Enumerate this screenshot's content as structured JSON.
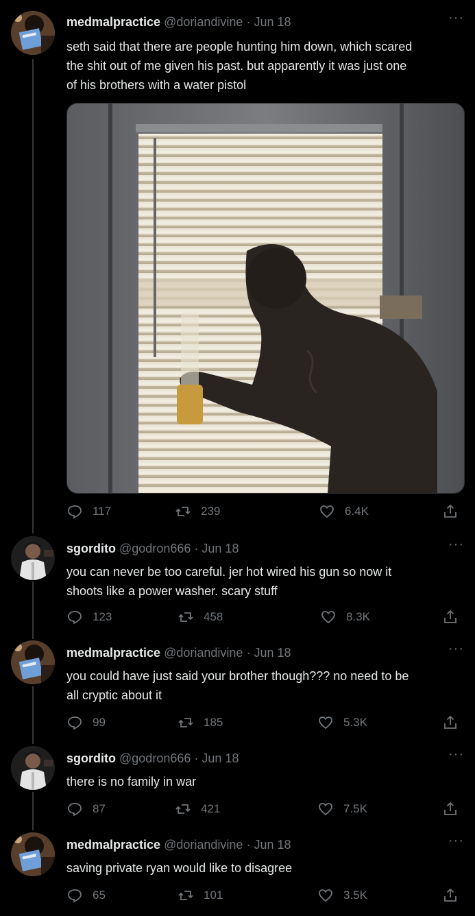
{
  "tweets": [
    {
      "name": "medmalpractice",
      "handle": "@doriandivine",
      "date": "Jun 18",
      "text_lines": [
        "seth said that there are people hunting him down, which scared",
        "the shit out of me given his past. but apparently it was just one",
        "of his brothers with a water pistol"
      ],
      "replies": "117",
      "retweets": "239",
      "likes": "6.4K"
    },
    {
      "name": "sgordito",
      "handle": "@godron666",
      "date": "Jun 18",
      "text_lines": [
        "you can never be too careful. jer hot wired his gun so now it",
        "shoots like a power washer. scary stuff"
      ],
      "replies": "123",
      "retweets": "458",
      "likes": "8.3K"
    },
    {
      "name": "medmalpractice",
      "handle": "@doriandivine",
      "date": "Jun 18",
      "text_lines": [
        "you could have just said your brother though??? no need to be",
        "all cryptic about it"
      ],
      "replies": "99",
      "retweets": "185",
      "likes": "5.3K"
    },
    {
      "name": "sgordito",
      "handle": "@godron666",
      "date": "Jun 18",
      "text_lines": [
        "there is no family in war"
      ],
      "replies": "87",
      "retweets": "421",
      "likes": "7.5K"
    },
    {
      "name": "medmalpractice",
      "handle": "@doriandivine",
      "date": "Jun 18",
      "text_lines": [
        "saving private ryan would like to disagree"
      ],
      "replies": "65",
      "retweets": "101",
      "likes": "3.5K"
    }
  ],
  "separator": "·",
  "more_glyph": "···",
  "icons": {
    "reply": "reply-icon",
    "retweet": "retweet-icon",
    "like": "heart-icon",
    "share": "share-icon",
    "more": "more-icon"
  },
  "colors": {
    "background": "#000000",
    "text": "#e7e9ea",
    "muted": "#71767b",
    "thread_line": "#333639"
  }
}
